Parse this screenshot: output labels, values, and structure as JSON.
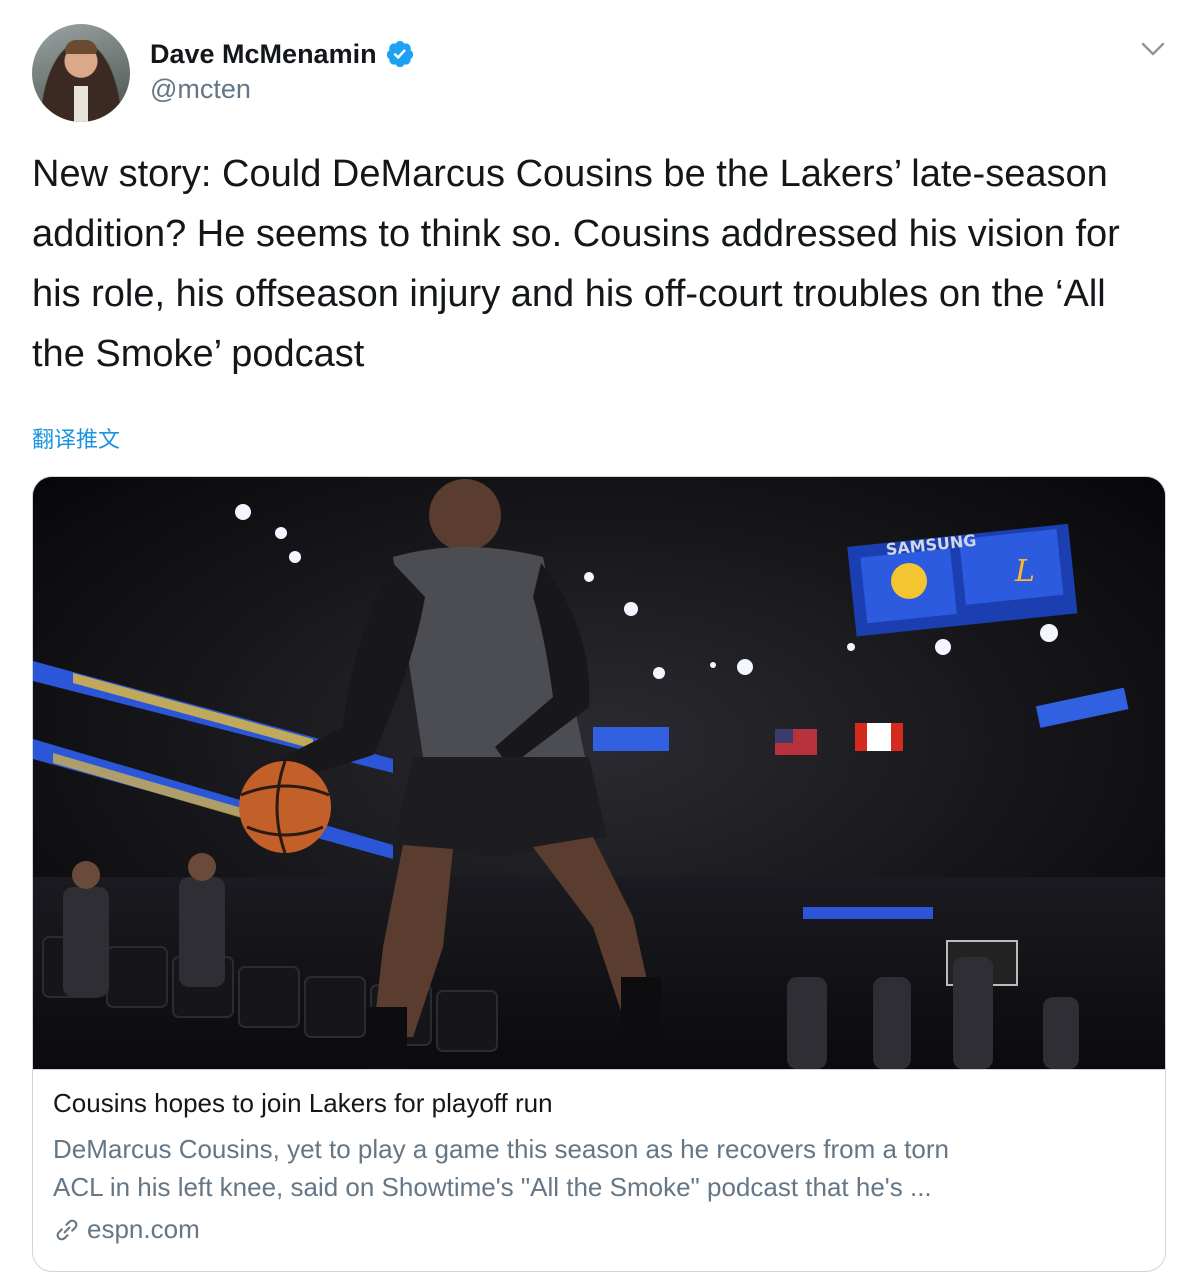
{
  "author": {
    "display_name": "Dave McMenamin",
    "handle": "@mcten",
    "verified": true,
    "avatar_icon": "user-avatar"
  },
  "tweet": {
    "text": "New story: Could DeMarcus Cousins be the Lakers’ late-season addition? He seems to think so. Cousins addressed his vision for his role, his offseason injury and his off-court troubles on the ‘All the Smoke’ podcast",
    "translate_label": "翻译推文"
  },
  "card": {
    "image_icon": "article-photo",
    "scoreboard_brand": "SAMSUNG",
    "title": "Cousins hopes to join Lakers for playoff run",
    "description_line1": "DeMarcus Cousins, yet to play a game this season as he recovers from a torn",
    "description_line2": "ACL in his left knee, said on Showtime's \"All the Smoke\" podcast that he's ...",
    "domain": "espn.com",
    "domain_icon": "link-icon"
  },
  "colors": {
    "text_primary": "#14171a",
    "text_secondary": "#657786",
    "link_blue": "#1b95e0",
    "verified_blue": "#1da1f2",
    "border": "#ccd6dd"
  }
}
